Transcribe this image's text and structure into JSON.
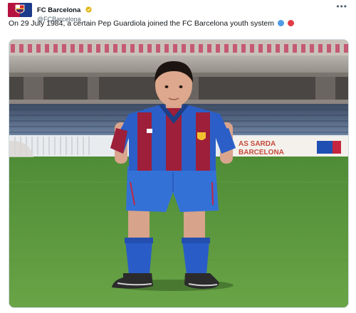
{
  "account": {
    "display_name": "FC Barcelona",
    "handle": "@FCBarcelona",
    "avatar_icon": "fc-barcelona-crest",
    "verified_icon": "verified-badge-icon",
    "more_icon": "more-options-icon"
  },
  "tweet": {
    "text": "On 29 July 1984, a certain Pep Guardiola joined the FC Barcelona youth system",
    "emoji_1": "blue-circle",
    "emoji_2": "red-circle"
  },
  "photo": {
    "ad_board_line1": "AS SARDA",
    "ad_board_line2": "BARCELONA",
    "colors": {
      "pitch": "#5f9a3f",
      "blue": "#2b5fc7",
      "garnet": "#9d1f3a",
      "stands": "#6d6a66"
    }
  }
}
